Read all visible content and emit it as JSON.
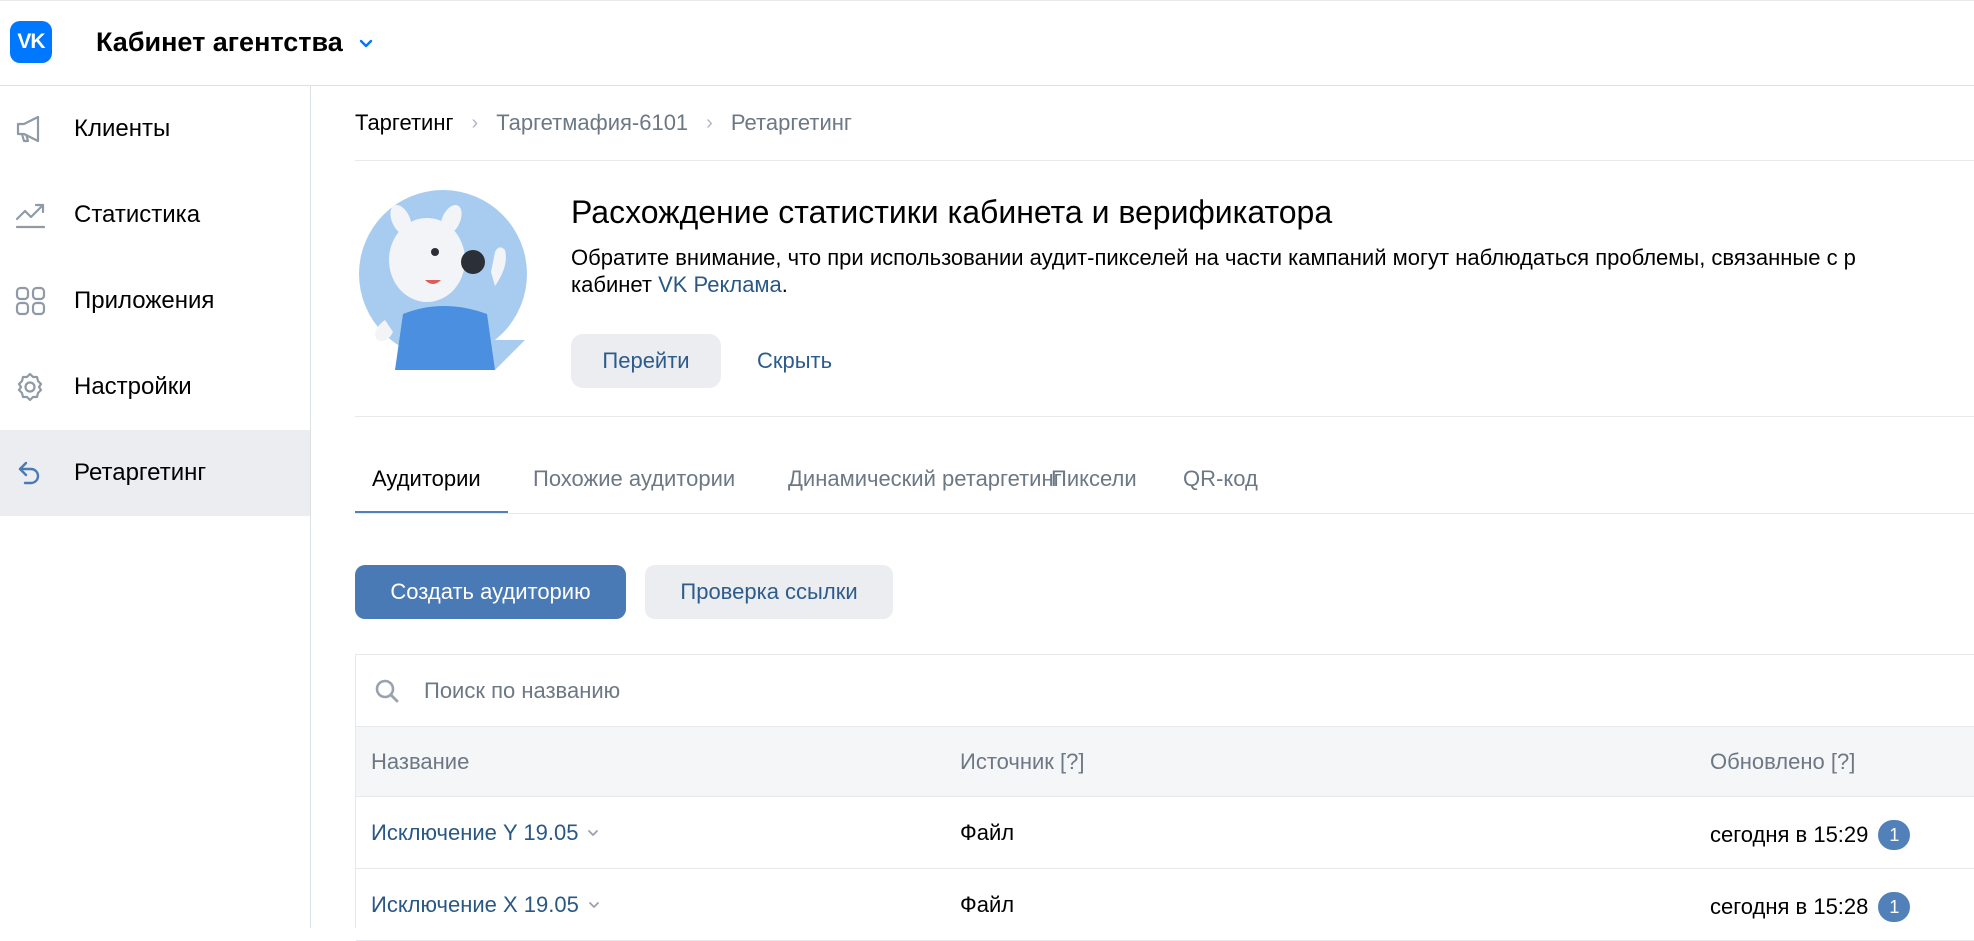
{
  "header": {
    "logo_text": "VK",
    "title": "Кабинет агентства",
    "accent": "#0077ff"
  },
  "sidebar": {
    "items": [
      {
        "label": "Клиенты",
        "icon": "megaphone-icon"
      },
      {
        "label": "Статистика",
        "icon": "chart-trend-icon"
      },
      {
        "label": "Приложения",
        "icon": "apps-grid-icon"
      },
      {
        "label": "Настройки",
        "icon": "gear-icon"
      },
      {
        "label": "Ретаргетинг",
        "icon": "retarget-arrow-icon",
        "active": true
      }
    ]
  },
  "breadcrumb": [
    "Таргетинг",
    "Таргетмафия-6101",
    "Ретаргетинг"
  ],
  "banner": {
    "title": "Расхождение статистики кабинета и верификатора",
    "text_line1": "Обратите внимание, что при использовании аудит-пикселей на части кампаний могут наблюдаться проблемы, связанные с р",
    "text_line2_prefix": "кабинет ",
    "text_line2_link": "VK Реклама",
    "text_line2_suffix": ".",
    "go_label": "Перейти",
    "hide_label": "Скрыть"
  },
  "tabs": [
    {
      "label": "Аудитории",
      "active": true
    },
    {
      "label": "Похожие аудитории"
    },
    {
      "label": "Динамический ретаргетинг"
    },
    {
      "label": "Пиксели"
    },
    {
      "label": "QR-код"
    }
  ],
  "actions": {
    "create_label": "Создать аудиторию",
    "check_label": "Проверка ссылки"
  },
  "table": {
    "search_placeholder": "Поиск по названию",
    "columns": [
      "Название",
      "Источник [?]",
      "Обновлено [?]"
    ],
    "rows": [
      {
        "name": "Исключение Y 19.05",
        "source": "Файл",
        "updated": "сегодня в 15:29",
        "badge": "1"
      },
      {
        "name": "Исключение X 19.05",
        "source": "Файл",
        "updated": "сегодня в 15:28",
        "badge": "1"
      }
    ]
  }
}
